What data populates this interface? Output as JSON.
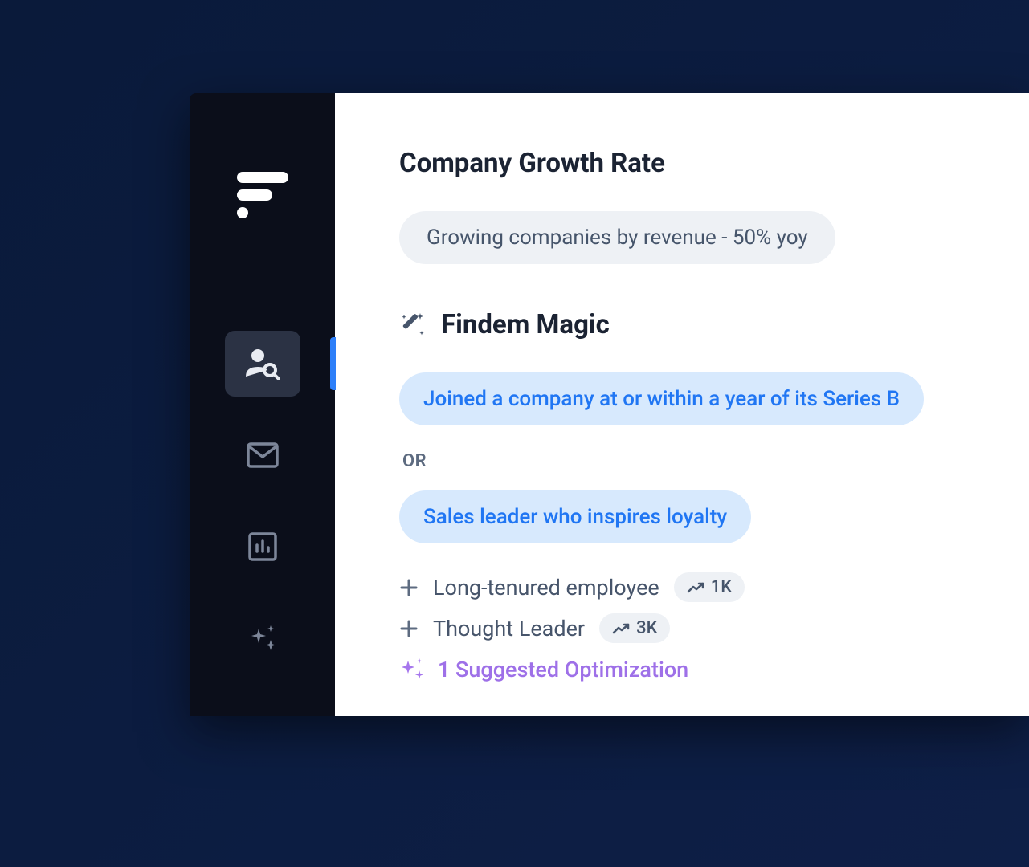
{
  "section1": {
    "title": "Company Growth Rate",
    "filter": "Growing companies by revenue - 50% yoy"
  },
  "section2": {
    "title": "Findem Magic",
    "pill1": "Joined a company at or within a year of its Series B",
    "divider": "OR",
    "pill2": "Sales leader who inspires loyalty"
  },
  "addRows": [
    {
      "label": "Long-tenured employee",
      "count": "1K"
    },
    {
      "label": "Thought Leader",
      "count": "3K"
    }
  ],
  "suggestion": {
    "text": "1 Suggested Optimization"
  }
}
